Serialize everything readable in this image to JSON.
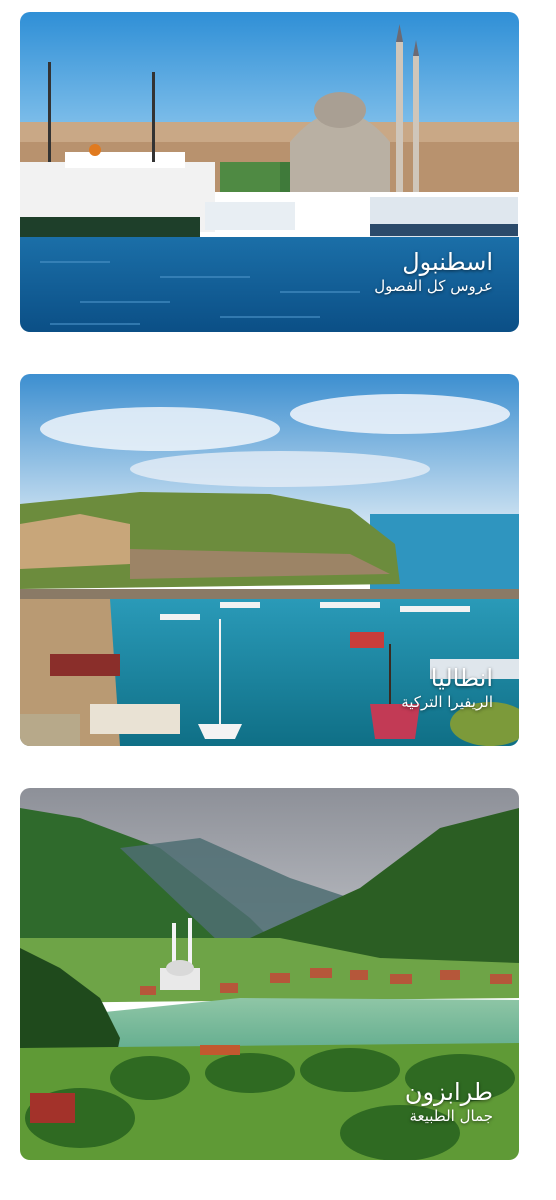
{
  "cards": [
    {
      "title": "اسطنبول",
      "subtitle": "عروس كل الفصول"
    },
    {
      "title": "انطاليا",
      "subtitle": "الريفيرا التركية"
    },
    {
      "title": "طرابزون",
      "subtitle": "جمال الطبيعة"
    }
  ]
}
